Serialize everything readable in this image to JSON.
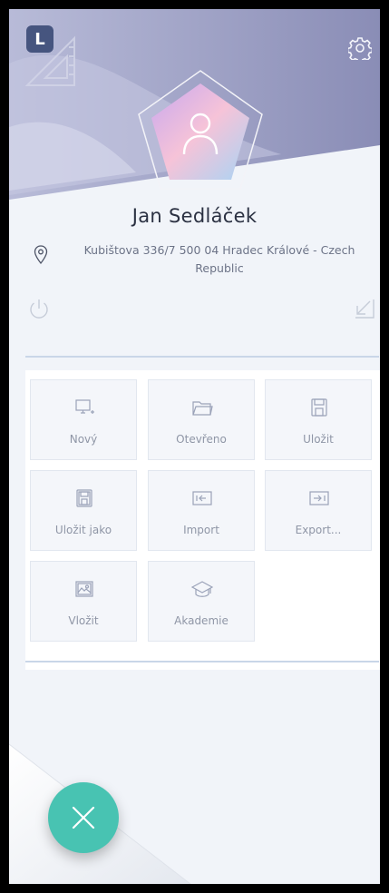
{
  "app": {
    "logo_letter": "L"
  },
  "profile": {
    "name": "Jan Sedláček",
    "address": "Kubištova 336/7 500 04 Hradec Králové - Czech Republic"
  },
  "menu": {
    "tiles": [
      {
        "label": "Nový",
        "icon": "new-monitor-icon"
      },
      {
        "label": "Otevřeno",
        "icon": "folder-icon"
      },
      {
        "label": "Uložit",
        "icon": "save-icon"
      },
      {
        "label": "Uložit jako",
        "icon": "save-as-icon"
      },
      {
        "label": "Import",
        "icon": "import-icon"
      },
      {
        "label": "Export...",
        "icon": "export-icon"
      },
      {
        "label": "Vložit",
        "icon": "insert-image-icon"
      },
      {
        "label": "Akademie",
        "icon": "academy-cap-icon"
      }
    ]
  },
  "colors": {
    "header": "#8f93bb",
    "accent": "#48c3b2",
    "divider": "#c9d6e8"
  }
}
